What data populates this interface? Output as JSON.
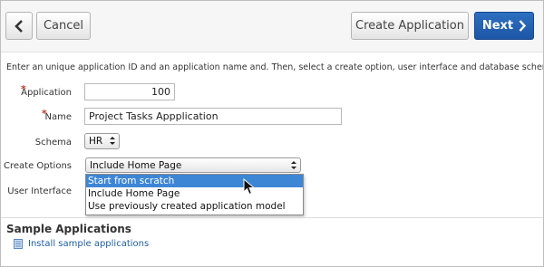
{
  "toolbar": {
    "back_icon": "chevron-left-icon",
    "cancel_label": "Cancel",
    "create_label": "Create Application",
    "next_label": "Next",
    "next_icon": "chevron-right-icon",
    "next_color": "#1d56a6"
  },
  "intro": "Enter an unique application ID and an application name and. Then, select a create option, user interface and database schema.",
  "form": {
    "application": {
      "label": "Application",
      "value": "100",
      "required": true
    },
    "name": {
      "label": "Name",
      "value": "Project Tasks Appplication",
      "required": true
    },
    "schema": {
      "label": "Schema",
      "value": "HR"
    },
    "create_options": {
      "label": "Create Options",
      "value": "Include Home Page",
      "options": [
        "Start from scratch",
        "Include Home Page",
        "Use previously created application model"
      ],
      "highlighted": "Start from scratch"
    },
    "user_interface": {
      "label": "User Interface"
    }
  },
  "sample": {
    "heading": "Sample Applications",
    "link": "Install sample applications",
    "link_icon": "document-icon"
  },
  "colors": {
    "required_star": "#c0392b",
    "highlight": "#3d86d6",
    "link": "#1f5fa8"
  }
}
